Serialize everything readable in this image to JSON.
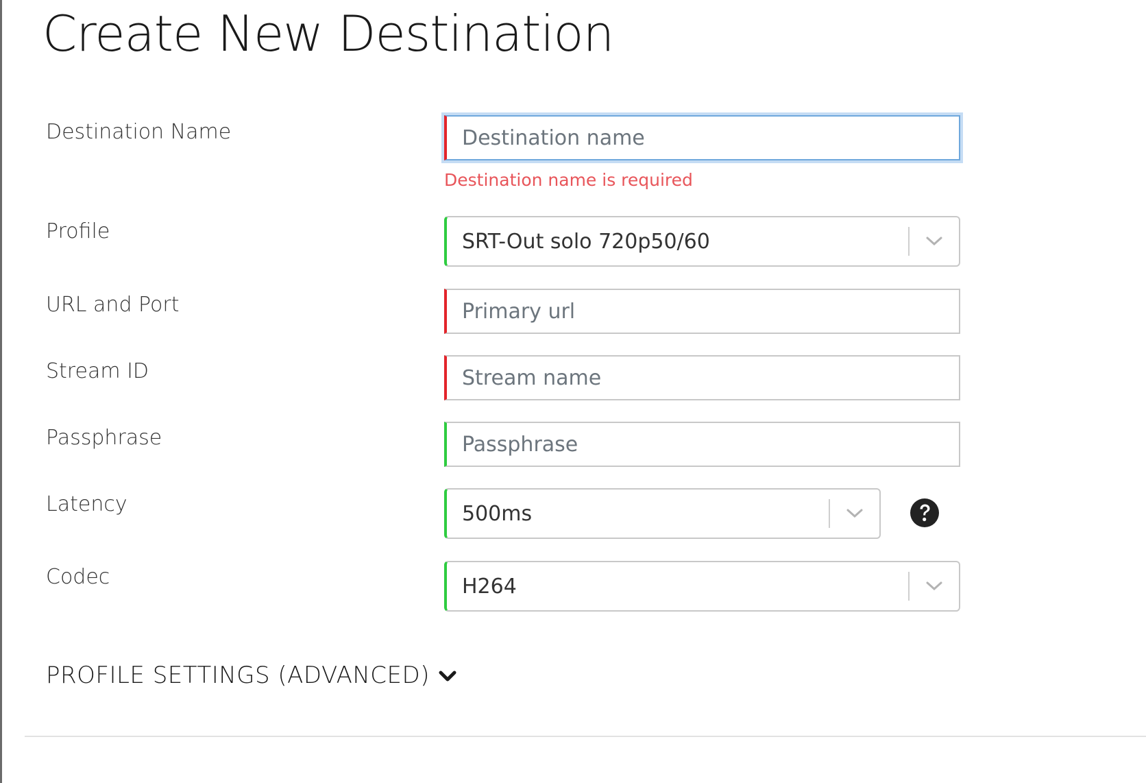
{
  "page": {
    "title": "Create New Destination"
  },
  "form": {
    "destination_name": {
      "label": "Destination Name",
      "placeholder": "Destination name",
      "value": "",
      "error": "Destination name is required"
    },
    "profile": {
      "label": "Profile",
      "selected": "SRT-Out solo 720p50/60"
    },
    "url_port": {
      "label": "URL and Port",
      "placeholder": "Primary url",
      "value": ""
    },
    "stream_id": {
      "label": "Stream ID",
      "placeholder": "Stream name",
      "value": ""
    },
    "passphrase": {
      "label": "Passphrase",
      "placeholder": "Passphrase",
      "value": ""
    },
    "latency": {
      "label": "Latency",
      "selected": "500ms",
      "help_icon": "question-circle-icon"
    },
    "codec": {
      "label": "Codec",
      "selected": "H264"
    }
  },
  "advanced": {
    "label": "PROFILE SETTINGS (ADVANCED)",
    "icon": "chevron-down-icon"
  },
  "colors": {
    "valid": "#2ecc40",
    "invalid": "#e3242b",
    "error_text": "#e8555a",
    "focus_border": "#6fa8dc",
    "focus_glow": "#c5dcf4"
  }
}
